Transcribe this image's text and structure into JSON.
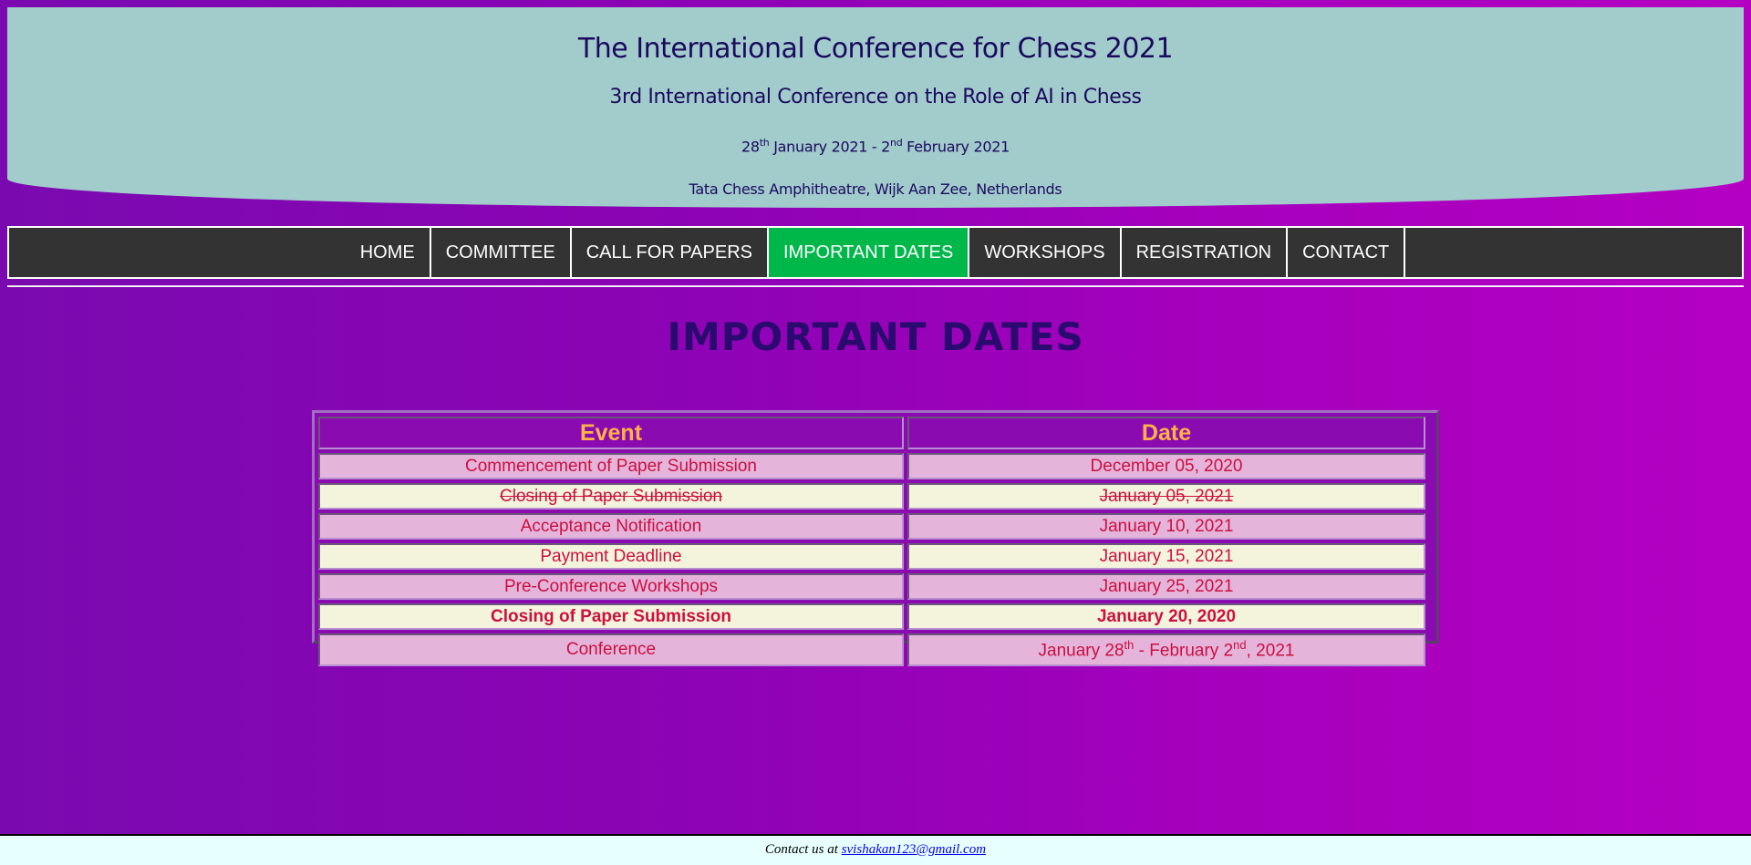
{
  "header": {
    "title": "The International Conference for Chess 2021",
    "subtitle": "3rd International Conference on the Role of AI in Chess",
    "dates": {
      "start_day": "28",
      "start_sup": "th",
      "start_rest": " January 2021 - 2",
      "end_sup": "nd",
      "end_rest": " February 2021"
    },
    "venue": "Tata Chess Amphitheatre, Wijk Aan Zee, Netherlands"
  },
  "nav": {
    "items": [
      "HOME",
      "COMMITTEE",
      "CALL FOR PAPERS",
      "IMPORTANT DATES",
      "WORKSHOPS",
      "REGISTRATION",
      "CONTACT"
    ],
    "active": "IMPORTANT DATES"
  },
  "page_title": "IMPORTANT DATES",
  "table": {
    "headers": [
      "Event",
      "Date"
    ],
    "rows": [
      {
        "event": "Commencement of Paper Submission",
        "date": "December 05, 2020"
      },
      {
        "event": "Closing of Paper Submission",
        "date": "January 05, 2021"
      },
      {
        "event": "Acceptance Notification",
        "date": "January 10, 2021"
      },
      {
        "event": "Payment Deadline",
        "date": "January 15, 2021"
      },
      {
        "event": "Pre-Conference Workshops",
        "date": "January 25, 2021"
      },
      {
        "event": "Closing of Paper Submission",
        "date": "January 20, 2020"
      },
      {
        "event": "Conference",
        "date_parts": [
          "January 28",
          "th",
          " - February 2",
          "nd",
          ", 2021"
        ]
      }
    ]
  },
  "footer": {
    "text": "Contact us at ",
    "email": "svishakan123@gmail.com"
  },
  "colors": {
    "banner_bg": "#a2cbcc",
    "nav_bg": "#333333",
    "nav_active": "#00b84a",
    "header_text": "#ffb347",
    "cell_text": "#cc1040",
    "row_pink": "#e4b4da",
    "row_cream": "#f4f4dc"
  }
}
